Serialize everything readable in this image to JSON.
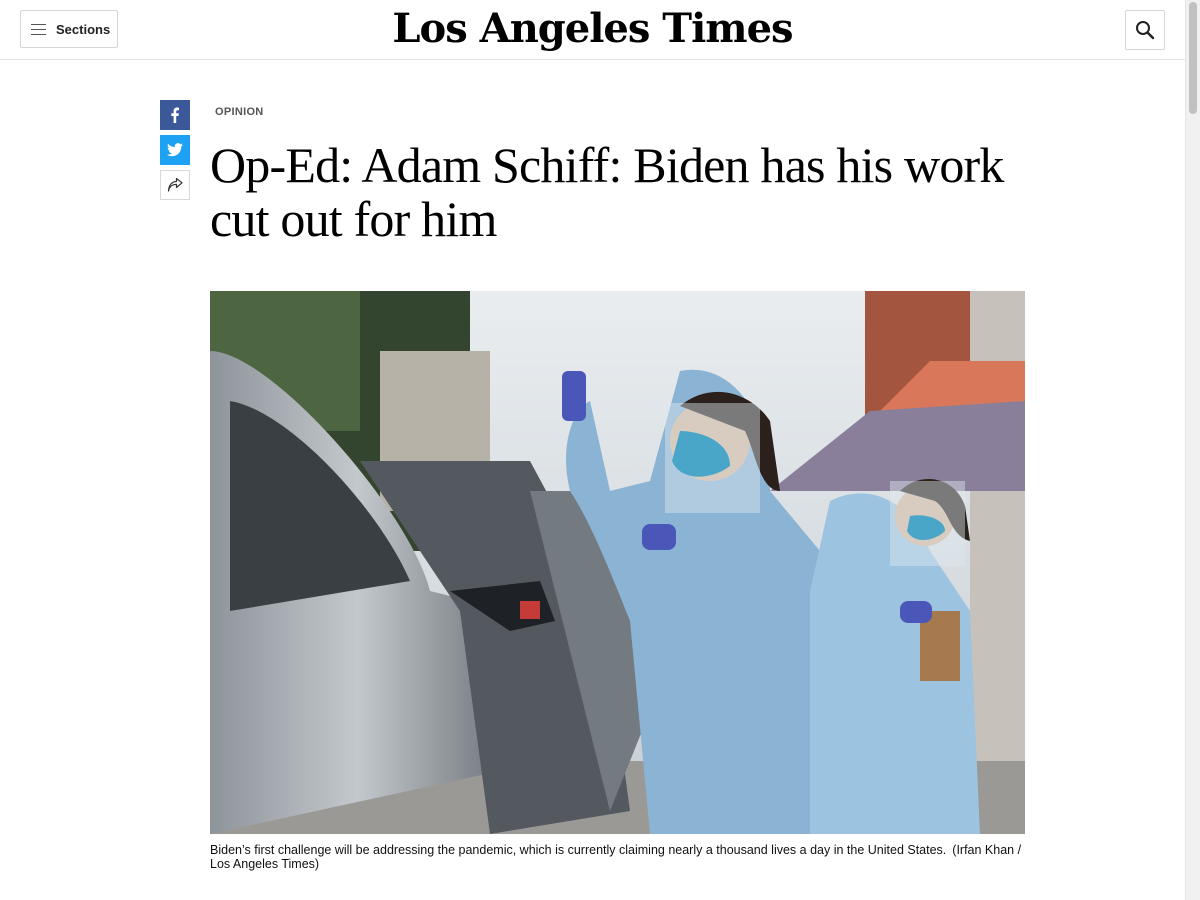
{
  "header": {
    "sections_label": "Sections",
    "logo_text": "Los Angeles Times",
    "icons": {
      "menu": "hamburger-menu-icon",
      "search": "search-icon"
    }
  },
  "share": {
    "icons": [
      "facebook-icon",
      "twitter-icon",
      "share-arrow-icon"
    ],
    "colors": {
      "facebook": "#3b5998",
      "twitter": "#1da1f2"
    }
  },
  "article": {
    "kicker": "OPINION",
    "headline": "Op-Ed: Adam Schiff: Biden has his work cut out for him",
    "image": {
      "caption": "Biden’s first challenge will be addressing the pandemic, which is currently claiming nearly a thousand lives a day in the United States.",
      "credit": "(Irfan Khan / Los Angeles Times)"
    }
  }
}
